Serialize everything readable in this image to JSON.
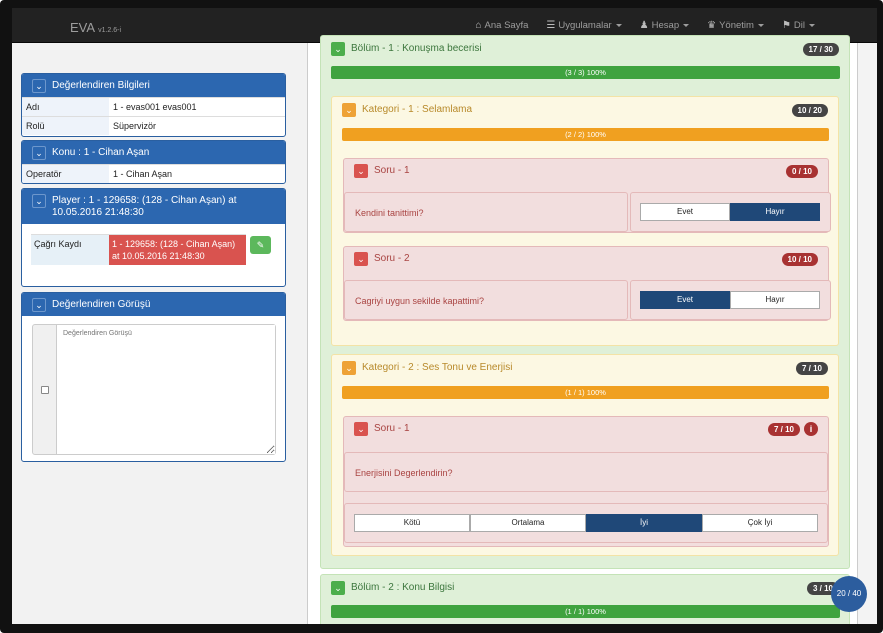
{
  "navbar": {
    "brand": "EVA",
    "version": "v1.2.6-i",
    "links": [
      {
        "label": "Ana Sayfa",
        "icon": "home-icon",
        "dropdown": false
      },
      {
        "label": "Uygulamalar",
        "icon": "list-icon",
        "dropdown": true
      },
      {
        "label": "Hesap",
        "icon": "user-icon",
        "dropdown": true
      },
      {
        "label": "Yönetim",
        "icon": "crown-icon",
        "dropdown": true
      },
      {
        "label": "Dil",
        "icon": "flag-icon",
        "dropdown": true
      }
    ]
  },
  "left": {
    "evaluator": {
      "title": "Değerlendiren Bilgileri",
      "rows": [
        {
          "key": "Adı",
          "value": "1 - evas001 evas001"
        },
        {
          "key": "Rolü",
          "value": "Süpervizör"
        }
      ]
    },
    "topic": {
      "title": "Konu : 1 - Cihan Aşan",
      "rows": [
        {
          "key": "Operatör",
          "value": "1 - Cihan Aşan"
        }
      ]
    },
    "player": {
      "title": "Player : 1 - 129658: (128 - Cihan Aşan) at 10.05.2016 21:48:30",
      "call_label": "Çağrı Kaydı",
      "call_value": "1 - 129658: (128 - Cihan Aşan) at 10.05.2016 21:48:30"
    },
    "opinion": {
      "title": "Değerlendiren Görüşü",
      "placeholder": "Değerlendiren Görüşü"
    }
  },
  "right": {
    "section1": {
      "title": "Bölüm - 1 : Konuşma becerisi",
      "badge": "17 / 30",
      "progress_label": "(3 / 3) 100%",
      "progress": 1.0
    },
    "cat1": {
      "title": "Kategori - 1 : Selamlama",
      "badge": "10 / 20",
      "progress_label": "(2 / 2) 100%",
      "progress": 1.0
    },
    "q1": {
      "title": "Soru - 1",
      "badge": "0 / 10",
      "text": "Kendini tanittimi?",
      "options": [
        "Evet",
        "Hayır"
      ],
      "selected": 1
    },
    "q2": {
      "title": "Soru - 2",
      "badge": "10 / 10",
      "text": "Cagriyi uygun sekilde kapattimi?",
      "options": [
        "Evet",
        "Hayır"
      ],
      "selected": 0
    },
    "cat2": {
      "title": "Kategori - 2 : Ses Tonu ve Enerjisi",
      "badge": "7 / 10",
      "progress_label": "(1 / 1) 100%",
      "progress": 1.0
    },
    "q3": {
      "title": "Soru - 1",
      "badge": "7 / 10",
      "text": "Enerjisini Degerlendirin?",
      "options": [
        "Kötü",
        "Ortalama",
        "İyi",
        "Çok İyi"
      ],
      "selected": 2
    },
    "section2": {
      "title": "Bölüm - 2 : Konu Bilgisi",
      "badge": "3 / 10",
      "progress_label": "(1 / 1) 100%",
      "progress": 1.0
    }
  },
  "score_total": "20 / 40"
}
